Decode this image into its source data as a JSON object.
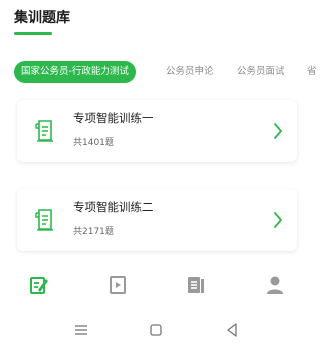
{
  "header": {
    "title": "集训题库"
  },
  "tabs": [
    {
      "label": "国家公务员-行政能力测试",
      "active": true
    },
    {
      "label": "公务员申论",
      "active": false
    },
    {
      "label": "公务员面试",
      "active": false
    }
  ],
  "tabs_more": "省",
  "cards": [
    {
      "name": "专项智能训练一",
      "count": "共1401题",
      "icon": "exam-paper-icon"
    },
    {
      "name": "专项智能训练二",
      "count": "共2171题",
      "icon": "exam-paper-icon"
    }
  ],
  "bottom_nav": [
    {
      "icon": "question-bank-icon",
      "active": true
    },
    {
      "icon": "video-play-icon",
      "active": false
    },
    {
      "icon": "document-list-icon",
      "active": false
    },
    {
      "icon": "user-profile-icon",
      "active": false
    }
  ],
  "system_nav": [
    "menu-icon",
    "home-icon",
    "back-icon"
  ],
  "colors": {
    "accent": "#2db84d",
    "inactive_icon": "#9a9a9a",
    "card_bg": "#ffffff"
  }
}
